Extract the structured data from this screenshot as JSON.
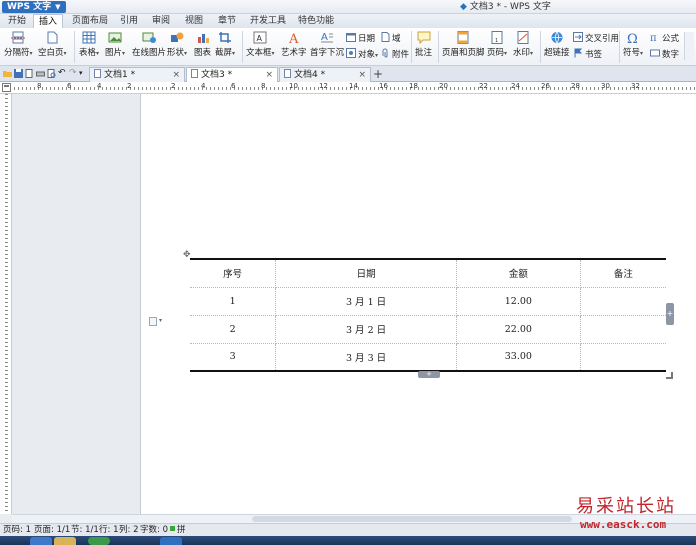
{
  "app": {
    "button_label": "WPS 文字",
    "window_title": "文档3 * - WPS 文字"
  },
  "menu": [
    "开始",
    "插入",
    "页面布局",
    "引用",
    "审阅",
    "视图",
    "章节",
    "开发工具",
    "特色功能"
  ],
  "menu_active": "插入",
  "ribbon": {
    "page_break": "分隔符",
    "blank_page": "空白页",
    "table": "表格",
    "picture": "图片",
    "online_picture": "在线图片",
    "shape": "形状",
    "chart": "图表",
    "screenshot": "截屏",
    "textbox": "文本框",
    "wordart": "艺术字",
    "dropcap": "首字下沉",
    "date": "日期",
    "object": "对象",
    "field": "域",
    "attachment": "附件",
    "comment": "批注",
    "header_footer": "页眉和页脚",
    "page_number": "页码",
    "watermark": "水印",
    "hyperlink": "超链接",
    "cross_reference": "交叉引用",
    "bookmark": "书签",
    "symbol": "符号",
    "formula": "公式",
    "number": "数字"
  },
  "doc_tabs": [
    {
      "label": "文档1 *",
      "active": false
    },
    {
      "label": "文档3 *",
      "active": true
    },
    {
      "label": "文档4 *",
      "active": false
    }
  ],
  "ruler_numbers": [
    "8",
    "6",
    "4",
    "2",
    "2",
    "4",
    "6",
    "8",
    "10",
    "12",
    "14",
    "16",
    "18",
    "20",
    "22",
    "24",
    "26",
    "28",
    "30",
    "32"
  ],
  "table": {
    "headers": [
      "序号",
      "日期",
      "金额",
      "备注"
    ],
    "rows": [
      [
        "1",
        "3 月 1 日",
        "12.00",
        ""
      ],
      [
        "2",
        "3 月 2 日",
        "22.00",
        ""
      ],
      [
        "3",
        "3 月 3 日",
        "33.00",
        ""
      ]
    ]
  },
  "status": {
    "page": "页码: 1",
    "pages": "页面: 1/1",
    "section": "节: 1/1",
    "row": "行: 1",
    "column": "列: 2",
    "words": "字数: 0",
    "spellcheck": "拼写检查"
  },
  "watermark": {
    "site": "易采站长站",
    "url": "www.easck.com"
  },
  "colors": {
    "accent": "#2f6fc0",
    "watermark": "#c0262d"
  }
}
